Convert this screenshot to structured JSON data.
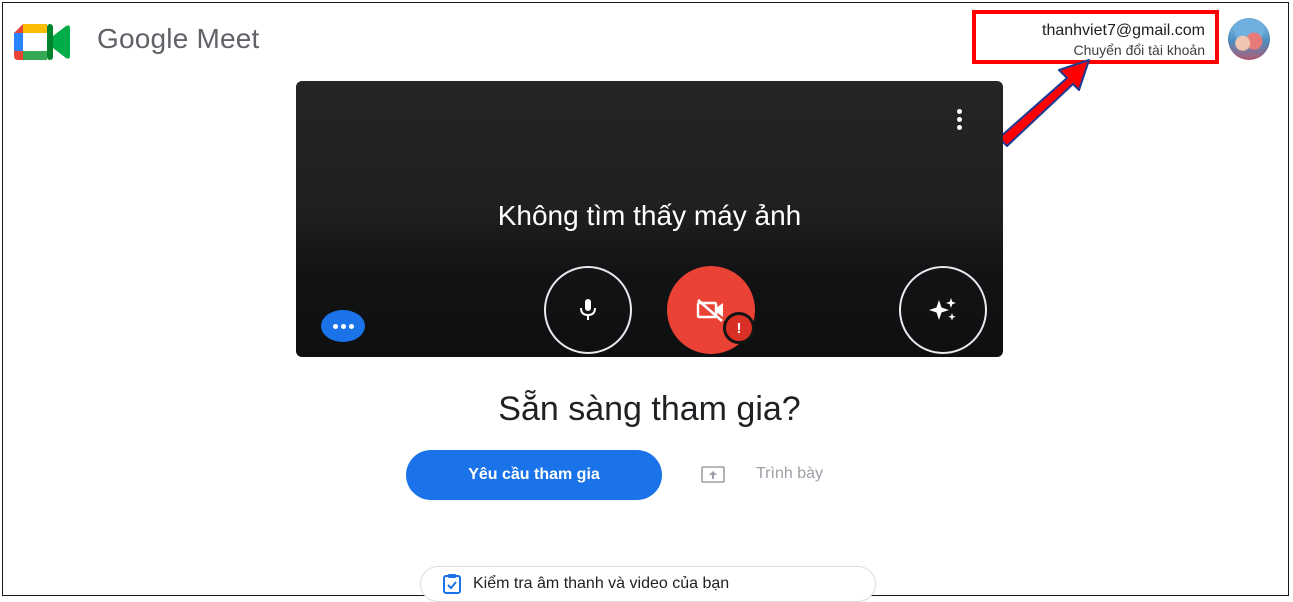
{
  "app": {
    "name": "Google Meet"
  },
  "account": {
    "email": "thanhviet7@gmail.com",
    "switch_label": "Chuyển đổi tài khoản"
  },
  "preview": {
    "status_text": "Không tìm thấy máy ảnh",
    "controls": [
      {
        "name": "microphone",
        "icon": "mic-icon",
        "state": "on"
      },
      {
        "name": "camera",
        "icon": "camera-off-icon",
        "state": "error"
      },
      {
        "name": "visual-effects",
        "icon": "sparkle-icon"
      }
    ],
    "more_options_icon": "more-vert-icon",
    "overflow_icon": "more-horiz-icon"
  },
  "join": {
    "heading": "Sẵn sàng tham gia?",
    "request_button": "Yêu cầu tham gia",
    "present_label": "Trình bày",
    "check_av_label": "Kiểm tra âm thanh và video của bạn"
  },
  "colors": {
    "accent": "#1a73e8",
    "camera_off": "#ea4335",
    "annotation": "#ff0000"
  }
}
